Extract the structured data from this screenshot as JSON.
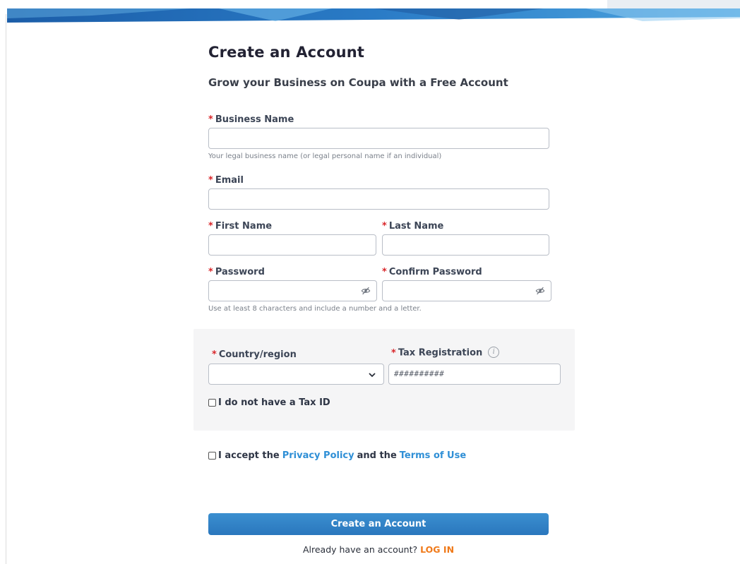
{
  "colors": {
    "accent": "#2a77bd",
    "link": "#2f8fd6",
    "required": "#d9262a",
    "login_link": "#f07a1a",
    "panel_bg": "#f5f5f6"
  },
  "header": {
    "title": "Create an Account",
    "subtitle": "Grow your Business on Coupa with a Free Account"
  },
  "form": {
    "required_mark": "*",
    "business_name": {
      "label": "Business Name",
      "value": "",
      "hint": "Your legal business name (or legal personal name if an individual)"
    },
    "email": {
      "label": "Email",
      "value": ""
    },
    "first_name": {
      "label": "First Name",
      "value": ""
    },
    "last_name": {
      "label": "Last Name",
      "value": ""
    },
    "password": {
      "label": "Password",
      "value": "",
      "icon": "eye-slash-icon",
      "hint": "Use at least 8 characters and include a number and a letter."
    },
    "confirm_password": {
      "label": "Confirm Password",
      "value": "",
      "icon": "eye-slash-icon"
    },
    "country": {
      "label": "Country/region",
      "selected": "",
      "icon": "chevron-down-icon"
    },
    "tax_registration": {
      "label": "Tax Registration",
      "value": "##########",
      "icon": "info-icon",
      "icon_glyph": "i"
    },
    "no_tax_id": {
      "label": "I do not have a Tax ID",
      "checked": false
    },
    "accept": {
      "prefix": "I accept the",
      "privacy_link": "Privacy Policy",
      "middle": "and the",
      "terms_link": "Terms of Use",
      "checked": false
    },
    "submit_label": "Create an Account"
  },
  "footer": {
    "prompt": "Already have an account?",
    "login_link": "LOG IN"
  }
}
